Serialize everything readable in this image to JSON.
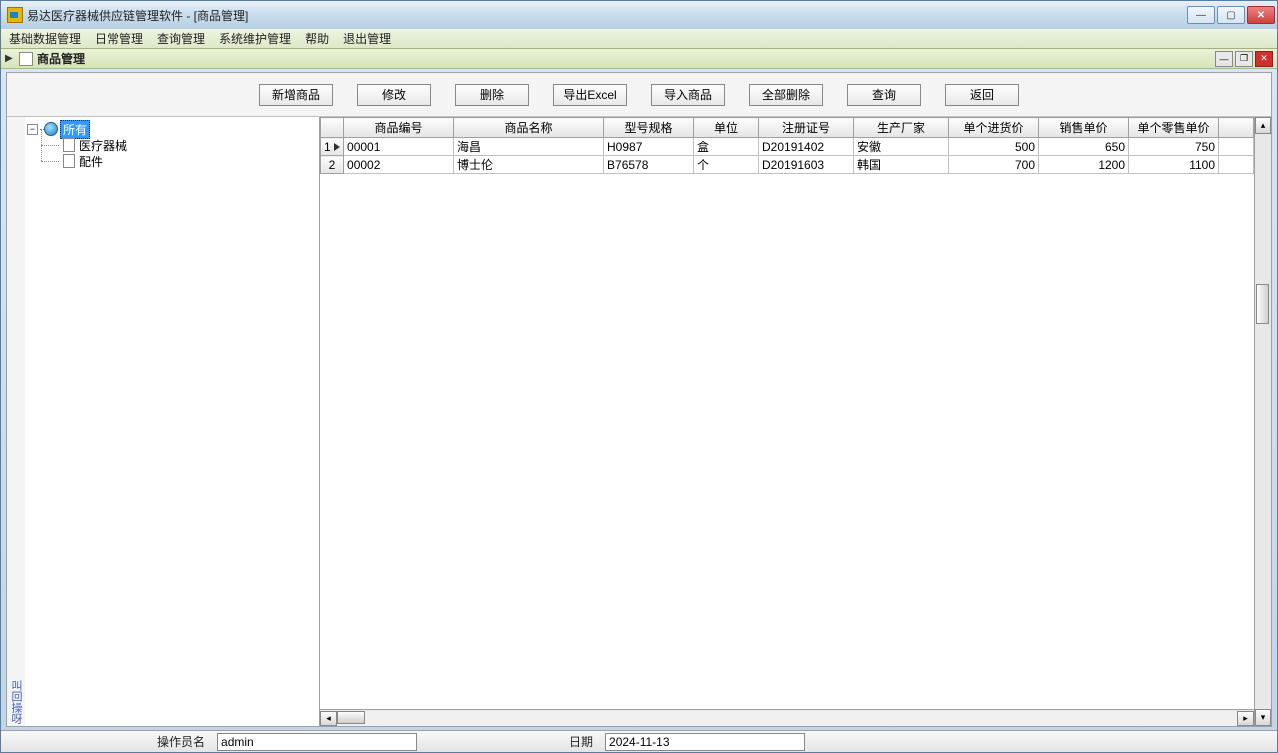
{
  "window": {
    "title": "易达医疗器械供应链管理软件 - [商品管理]"
  },
  "menu": {
    "items": [
      "基础数据管理",
      "日常管理",
      "查询管理",
      "系统维护管理",
      "帮助",
      "退出管理"
    ]
  },
  "mdi": {
    "title": "商品管理"
  },
  "toolbar": {
    "add": "新增商品",
    "edit": "修改",
    "delete": "删除",
    "export": "导出Excel",
    "import": "导入商品",
    "delall": "全部删除",
    "query": "查询",
    "back": "返回"
  },
  "tree": {
    "root": "所有",
    "children": [
      "医疗器械",
      "配件"
    ]
  },
  "grid": {
    "columns": [
      "商品编号",
      "商品名称",
      "型号规格",
      "单位",
      "注册证号",
      "生产厂家",
      "单个进货价",
      "销售单价",
      "单个零售单价"
    ],
    "rows": [
      {
        "id": "00001",
        "name": "海昌",
        "spec": "H0987",
        "unit": "盒",
        "reg": "D20191402",
        "mfr": "安徽",
        "cost": "500",
        "sale": "650",
        "retail": "750"
      },
      {
        "id": "00002",
        "name": "博士伦",
        "spec": "B76578",
        "unit": "个",
        "reg": "D20191603",
        "mfr": "韩国",
        "cost": "700",
        "sale": "1200",
        "retail": "1100"
      }
    ]
  },
  "status": {
    "op_label": "操作员名",
    "op_value": "admin",
    "date_label": "日期",
    "date_value": "2024-11-13"
  },
  "sidetext": "叫回操呀"
}
